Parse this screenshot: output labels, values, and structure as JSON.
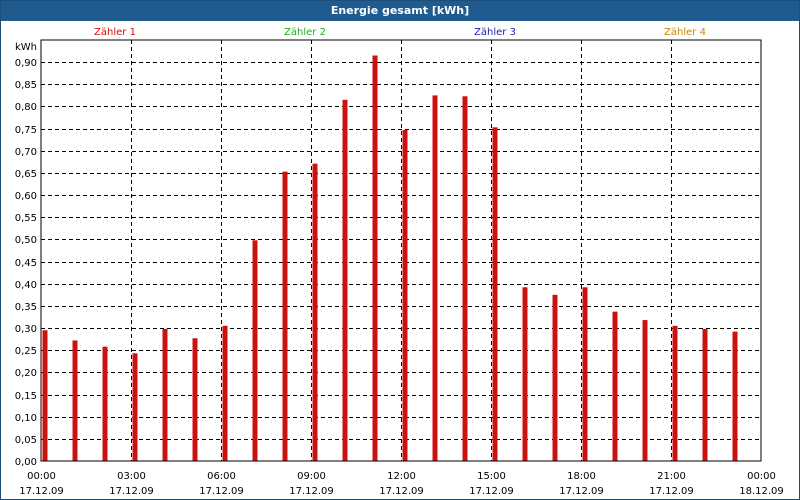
{
  "window": {
    "title": "Energie gesamt [kWh]"
  },
  "legend": [
    {
      "label": "Zähler 1",
      "color": "#cc1111"
    },
    {
      "label": "Zähler 2",
      "color": "#22aa22"
    },
    {
      "label": "Zähler 3",
      "color": "#2222aa"
    },
    {
      "label": "Zähler 4",
      "color": "#cc8800"
    }
  ],
  "chart_data": {
    "type": "bar",
    "title": "Energie gesamt [kWh]",
    "ylabel": "kWh",
    "ylim": [
      0,
      0.95
    ],
    "yticks": [
      "0,00",
      "0,05",
      "0,10",
      "0,15",
      "0,20",
      "0,25",
      "0,30",
      "0,35",
      "0,40",
      "0,45",
      "0,50",
      "0,55",
      "0,60",
      "0,65",
      "0,70",
      "0,75",
      "0,80",
      "0,85",
      "0,90"
    ],
    "x_hours": [
      0,
      1,
      2,
      3,
      4,
      5,
      6,
      7,
      8,
      9,
      10,
      11,
      12,
      13,
      14,
      15,
      16,
      17,
      18,
      19,
      20,
      21,
      22,
      23
    ],
    "xticks": [
      {
        "time": "00:00",
        "date": "17.12.09"
      },
      {
        "time": "03:00",
        "date": "17.12.09"
      },
      {
        "time": "06:00",
        "date": "17.12.09"
      },
      {
        "time": "09:00",
        "date": "17.12.09"
      },
      {
        "time": "12:00",
        "date": "17.12.09"
      },
      {
        "time": "15:00",
        "date": "17.12.09"
      },
      {
        "time": "18:00",
        "date": "17.12.09"
      },
      {
        "time": "21:00",
        "date": "17.12.09"
      },
      {
        "time": "00:00",
        "date": "18.12.09"
      }
    ],
    "xlim_hours": [
      0,
      24
    ],
    "series": [
      {
        "color": "#cc1111",
        "values": [
          0.295,
          0.272,
          0.258,
          0.243,
          0.298,
          0.277,
          0.305,
          0.498,
          0.653,
          0.671,
          0.815,
          0.915,
          0.747,
          0.825,
          0.823,
          0.753,
          0.392,
          0.375,
          0.392,
          0.337,
          0.318,
          0.305,
          0.298,
          0.292
        ]
      }
    ],
    "grid": true
  }
}
